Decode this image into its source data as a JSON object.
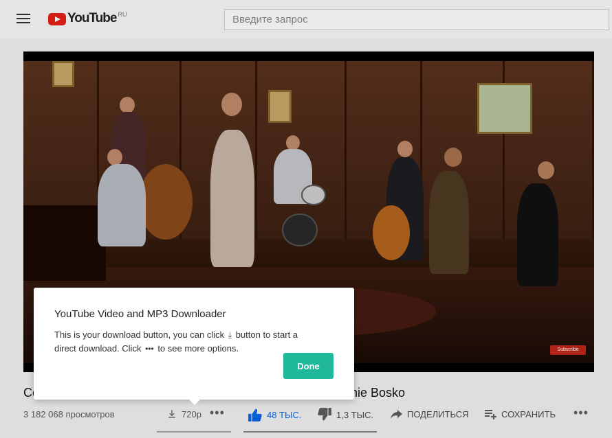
{
  "header": {
    "logo_text": "YouTube",
    "logo_region": "RU",
    "search_placeholder": "Введите запрос"
  },
  "video": {
    "title_start": "Co",
    "title_end": "nie Bosko",
    "subscribe_badge": "Subscribe",
    "views": "3 182 068 просмотров"
  },
  "actions": {
    "download_quality": "720p",
    "more_label": "•••",
    "likes": "48 ТЫС.",
    "dislikes": "1,3 ТЫС.",
    "share": "ПОДЕЛИТЬСЯ",
    "save": "СОХРАНИТЬ",
    "menu_label": "•••"
  },
  "popup": {
    "title": "YouTube Video and MP3 Downloader",
    "body_part1": "This is your download button, you can click",
    "body_part2": "button to start a",
    "body_part3": "direct download. Click",
    "body_part4": "to see more options.",
    "dots_glyph": "•••",
    "done_label": "Done"
  },
  "colors": {
    "accent_blue": "#065fd4",
    "done_green": "#1fb89a",
    "brand_red": "#e62117"
  }
}
